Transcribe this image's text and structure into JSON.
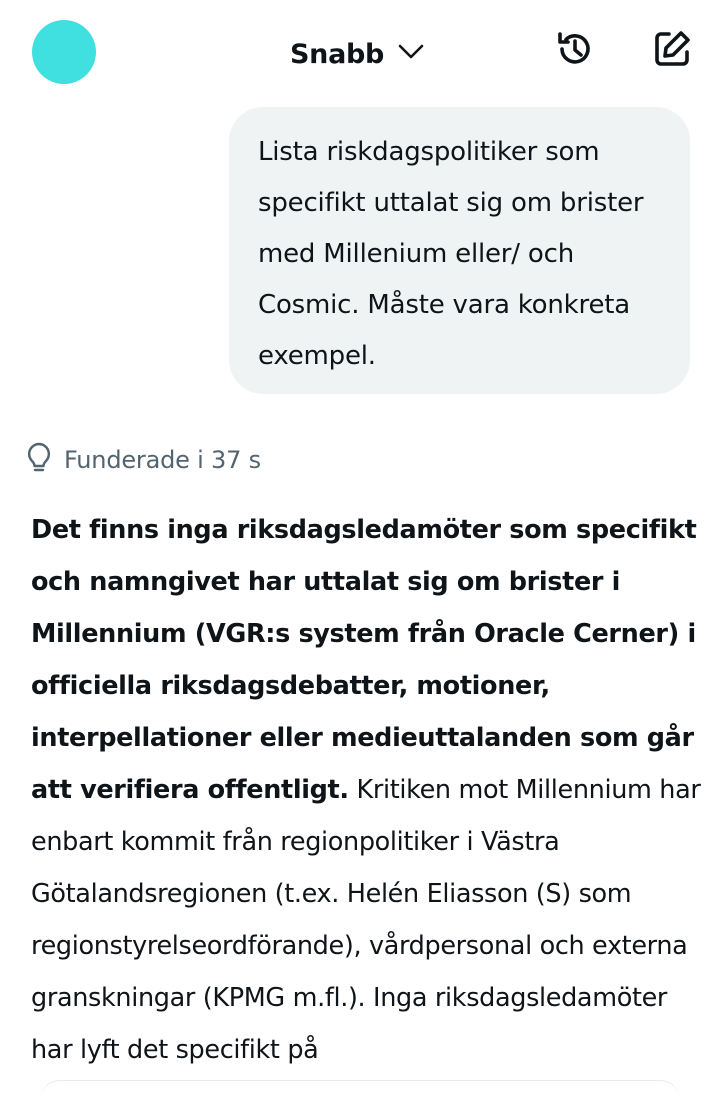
{
  "header": {
    "model_label": "Snabb",
    "icons": {
      "avatar": "avatar",
      "dropdown": "chevron-down-icon",
      "history": "history-icon",
      "compose": "compose-icon"
    },
    "avatar_color": "#40e0e0"
  },
  "conversation": {
    "user_message": "Lista riskdagspolitiker som specifikt uttalat sig om brister med Millenium eller/ och Cosmic. Måste vara konkreta exempel.",
    "thought": {
      "icon": "lightbulb-icon",
      "label": "Funderade i 37 s"
    },
    "answer": {
      "bold_part": "Det finns inga riksdagsledamöter som specifikt och namngivet har uttalat sig om brister i Millennium (VGR:s system från Oracle Cerner) i officiella riksdagsdebatter, motioner, interpellationer eller medieuttalanden som går att verifiera offentligt.",
      "regular_part": " Kritiken mot Millennium har enbart kommit från regionpolitiker i Västra Götalandsregionen (t.ex. Helén Eliasson (S) som regionstyrelseordförande), vårdpersonal och externa granskningar (KPMG m.fl.). Inga riksdagsledamöter har lyft det specifikt på"
    }
  }
}
